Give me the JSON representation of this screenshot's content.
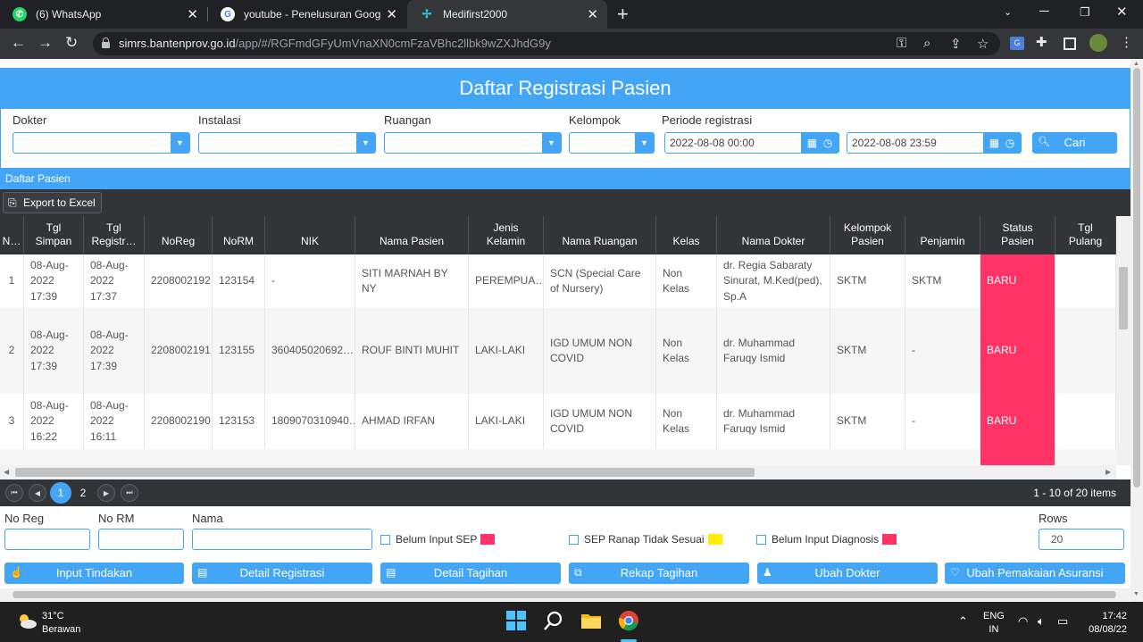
{
  "browser": {
    "tabs": [
      {
        "title": "(6) WhatsApp",
        "active": false
      },
      {
        "title": "youtube - Penelusuran Google",
        "active": false
      },
      {
        "title": "Medifirst2000",
        "active": true
      }
    ],
    "url_domain": "simrs.bantenprov.go.id",
    "url_path": "/app/#/RGFmdGFyUmVnaXN0cmFzaVBhc2llbk9wZXJhdG9y"
  },
  "page": {
    "title": "Daftar Registrasi Pasien",
    "filters": {
      "dokter_label": "Dokter",
      "instalasi_label": "Instalasi",
      "ruangan_label": "Ruangan",
      "kelompok_label": "Kelompok",
      "periode_label": "Periode registrasi",
      "date_from": "2022-08-08 00:00",
      "date_to": "2022-08-08 23:59",
      "search_label": "Cari"
    },
    "section_title": "Daftar Pasien",
    "export_label": "Export to Excel",
    "columns": [
      "N…",
      "Tgl\nSimpan",
      "Tgl\nRegistr…",
      "NoReg",
      "NoRM",
      "NIK",
      "Nama Pasien",
      "Jenis\nKelamin",
      "Nama Ruangan",
      "Kelas",
      "Nama Dokter",
      "Kelompok\nPasien",
      "Penjamin",
      "Status\nPasien",
      "Tgl\nPulang"
    ],
    "rows": [
      {
        "no": "1",
        "tgl_simpan": "08-Aug-2022 17:39",
        "tgl_registrasi": "08-Aug-2022 17:37",
        "noreg": "2208002192",
        "norm": "123154",
        "nik": "-",
        "nama_pasien": "SITI MARNAH BY NY",
        "jenis_kelamin": "PEREMPUA…",
        "nama_ruangan": "SCN (Special Care of Nursery)",
        "kelas": "Non Kelas",
        "nama_dokter": "dr. Regia Sabaraty Sinurat, M.Ked(ped), Sp.A",
        "kelompok_pasien": "SKTM",
        "penjamin": "SKTM",
        "status_pasien": "BARU",
        "tgl_pulang": ""
      },
      {
        "no": "2",
        "tgl_simpan": "08-Aug-2022 17:39",
        "tgl_registrasi": "08-Aug-2022 17:39",
        "noreg": "2208002191",
        "norm": "123155",
        "nik": "360405020692…",
        "nama_pasien": "ROUF BINTI MUHIT",
        "jenis_kelamin": "LAKI-LAKI",
        "nama_ruangan": "IGD UMUM NON COVID",
        "kelas": "Non Kelas",
        "nama_dokter": "dr. Muhammad Faruqy Ismid",
        "kelompok_pasien": "SKTM",
        "penjamin": "-",
        "status_pasien": "BARU",
        "tgl_pulang": ""
      },
      {
        "no": "3",
        "tgl_simpan": "08-Aug-2022 16:22",
        "tgl_registrasi": "08-Aug-2022 16:11",
        "noreg": "2208002190",
        "norm": "123153",
        "nik": "1809070310940…",
        "nama_pasien": "AHMAD IRFAN",
        "jenis_kelamin": "LAKI-LAKI",
        "nama_ruangan": "IGD UMUM NON COVID",
        "kelas": "Non Kelas",
        "nama_dokter": "dr. Muhammad Faruqy Ismid",
        "kelompok_pasien": "SKTM",
        "penjamin": "-",
        "status_pasien": "BARU",
        "tgl_pulang": ""
      }
    ],
    "pager": {
      "pages": [
        "1",
        "2"
      ],
      "current_page": 1,
      "info": "1 - 10 of 20 items"
    },
    "bottom": {
      "noreg_label": "No Reg",
      "norm_label": "No RM",
      "nama_label": "Nama",
      "check_sep": "Belum Input SEP",
      "check_ranap": "SEP Ranap Tidak Sesuai",
      "check_diag": "Belum Input Diagnosis",
      "rows_label": "Rows",
      "rows_value": "20",
      "actions": [
        "Input Tindakan",
        "Detail Registrasi",
        "Detail Tagihan",
        "Rekap Tagihan",
        "Ubah Dokter",
        "Ubah Pemakaian Asuransi"
      ]
    }
  },
  "taskbar": {
    "temp": "31°C",
    "weather": "Berawan",
    "lang_1": "ENG",
    "lang_2": "IN",
    "time": "17:42",
    "date": "08/08/22"
  },
  "colors": {
    "accent": "#42a5f5",
    "dark": "#313538",
    "status_baru": "#ff3366",
    "swatch_red": "#ff3366",
    "swatch_yellow": "#ffee00"
  }
}
